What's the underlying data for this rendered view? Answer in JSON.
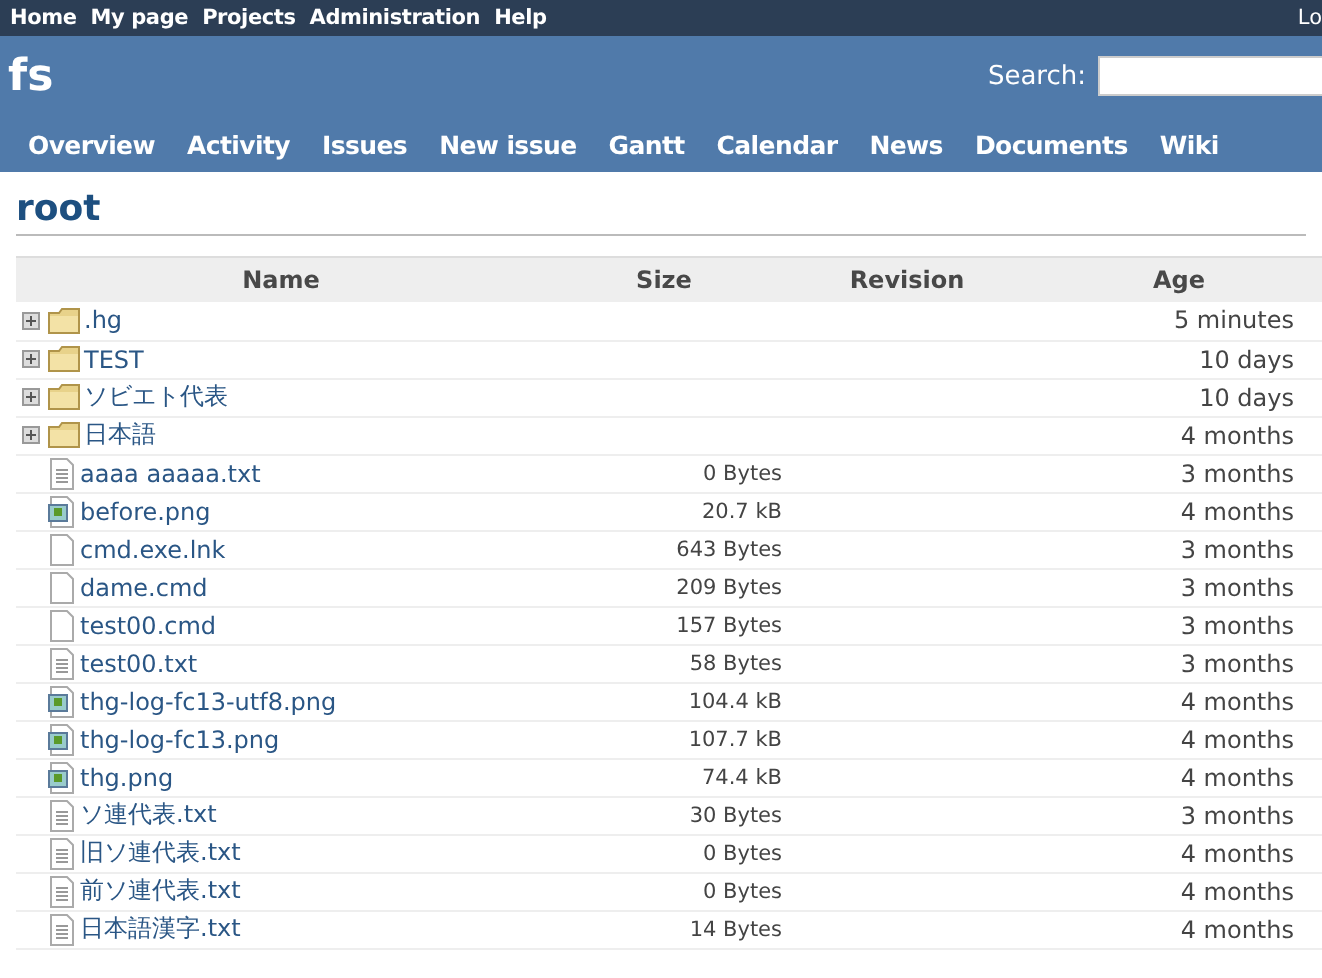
{
  "top_menu": [
    "Home",
    "My page",
    "Projects",
    "Administration",
    "Help"
  ],
  "account_menu": "Lo",
  "project": {
    "title": "fs"
  },
  "search": {
    "label": "Search:"
  },
  "tabs": [
    "Overview",
    "Activity",
    "Issues",
    "New issue",
    "Gantt",
    "Calendar",
    "News",
    "Documents",
    "Wiki"
  ],
  "page_title": "root",
  "table": {
    "columns": [
      "Name",
      "Size",
      "Revision",
      "Age"
    ],
    "rows": [
      {
        "kind": "folder",
        "name": ".hg",
        "age": "5 minutes"
      },
      {
        "kind": "folder",
        "name": "TEST",
        "age": "10 days"
      },
      {
        "kind": "folder",
        "name": "ソビエト代表",
        "age": "10 days"
      },
      {
        "kind": "folder",
        "name": "日本語",
        "age": "4 months"
      },
      {
        "kind": "text",
        "name": "aaaa aaaaa.txt",
        "size": "0 Bytes",
        "age": "3 months"
      },
      {
        "kind": "image",
        "name": "before.png",
        "size": "20.7 kB",
        "age": "4 months"
      },
      {
        "kind": "file",
        "name": "cmd.exe.lnk",
        "size": "643 Bytes",
        "age": "3 months"
      },
      {
        "kind": "file",
        "name": "dame.cmd",
        "size": "209 Bytes",
        "age": "3 months"
      },
      {
        "kind": "file",
        "name": "test00.cmd",
        "size": "157 Bytes",
        "age": "3 months"
      },
      {
        "kind": "text",
        "name": "test00.txt",
        "size": "58 Bytes",
        "age": "3 months"
      },
      {
        "kind": "image",
        "name": "thg-log-fc13-utf8.png",
        "size": "104.4 kB",
        "age": "4 months"
      },
      {
        "kind": "image",
        "name": "thg-log-fc13.png",
        "size": "107.7 kB",
        "age": "4 months"
      },
      {
        "kind": "image",
        "name": "thg.png",
        "size": "74.4 kB",
        "age": "4 months"
      },
      {
        "kind": "text",
        "name": "ソ連代表.txt",
        "size": "30 Bytes",
        "age": "3 months"
      },
      {
        "kind": "text",
        "name": "旧ソ連代表.txt",
        "size": "0 Bytes",
        "age": "4 months"
      },
      {
        "kind": "text",
        "name": "前ソ連代表.txt",
        "size": "0 Bytes",
        "age": "4 months"
      },
      {
        "kind": "text",
        "name": "日本語漢字.txt",
        "size": "14 Bytes",
        "age": "4 months"
      }
    ]
  }
}
